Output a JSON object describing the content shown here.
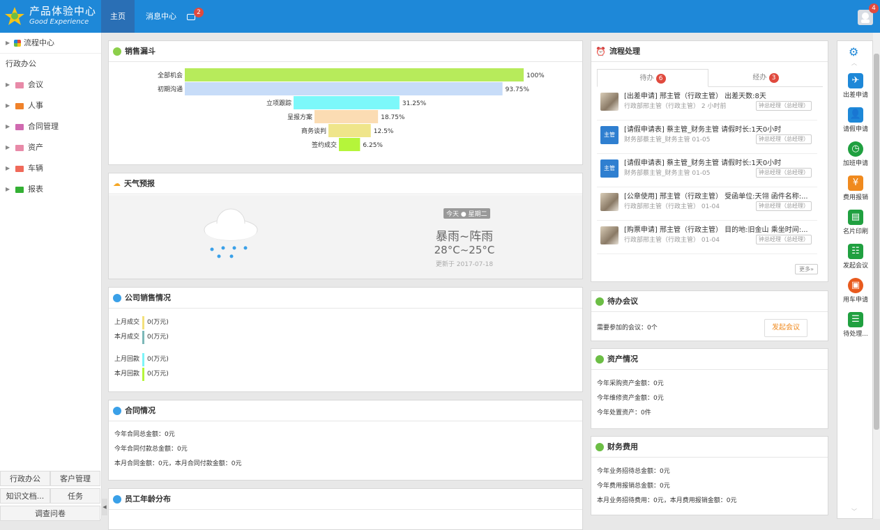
{
  "topbar": {
    "brand_title": "产品体验中心",
    "brand_subtitle": "Good Experience",
    "nav_home": "主页",
    "nav_messages": "消息中心",
    "task_badge": "2",
    "user_badge": "4"
  },
  "sidebar": {
    "process_center": "流程中心",
    "group_title": "行政办公",
    "items": [
      {
        "label": "会议",
        "color": "#e88aa8"
      },
      {
        "label": "人事",
        "color": "#f0822a"
      },
      {
        "label": "合同管理",
        "color": "#d06ab0"
      },
      {
        "label": "资产",
        "color": "#e88aa8"
      },
      {
        "label": "车辆",
        "color": "#f06a5a"
      },
      {
        "label": "报表",
        "color": "#34b034"
      }
    ],
    "bottom_tabs": [
      "行政办公",
      "客户管理",
      "知识文档...",
      "任务",
      "调查问卷"
    ]
  },
  "sales_funnel": {
    "title": "销售漏斗",
    "chart_data": {
      "type": "bar",
      "categories": [
        "全部机会",
        "初期沟通",
        "立项跟踪",
        "呈报方案",
        "商务谈判",
        "签约成交"
      ],
      "values": [
        100,
        93.75,
        31.25,
        18.75,
        12.5,
        6.25
      ],
      "value_labels": [
        "100%",
        "93.75%",
        "31.25%",
        "18.75%",
        "12.5%",
        "6.25%"
      ],
      "colors": [
        "#b7eb5b",
        "#c7dcf8",
        "#7cf8fa",
        "#fbdcb3",
        "#efe58a",
        "#b5f53a"
      ]
    }
  },
  "weather": {
    "title": "天气预报",
    "day": "今天 ● 星期二",
    "condition": "暴雨~阵雨",
    "temperature": "28°C~25°C",
    "updated": "更新于 2017-07-18"
  },
  "company_sales": {
    "title": "公司销售情况",
    "rows": [
      {
        "label": "上月成交",
        "value": "0(万元)",
        "color": "#f3e07a"
      },
      {
        "label": "本月成交",
        "value": "0(万元)",
        "color": "#7cb8b8"
      },
      {
        "label": "上月回款",
        "value": "0(万元)",
        "color": "#7cf4f8"
      },
      {
        "label": "本月回款",
        "value": "0(万元)",
        "color": "#b5f53a"
      }
    ]
  },
  "contracts": {
    "title": "合同情况",
    "lines": [
      "今年合同总金额：0元",
      "今年合同付款总金额：0元",
      "本月合同金额：0元，本月合同付款金额：0元"
    ]
  },
  "employee_age": {
    "title": "员工年龄分布"
  },
  "workflow": {
    "title": "流程处理",
    "tab_todo": "待办",
    "tab_todo_count": "6",
    "tab_done": "经办",
    "tab_done_count": "3",
    "items": [
      {
        "title": "[出差申请] 邢主管（行政主管） 出差天数:8天",
        "sub": "行政部邢主管（行政主管） 2 小时前",
        "tag": "钟总经理（总经理）",
        "avatar": "photo"
      },
      {
        "title": "[请假申请表] 蔡主管_财务主管 请假时长:1天0小时",
        "sub": "财务部蔡主管_财务主管 01-05",
        "tag": "钟总经理（总经理）",
        "avatar": "主管"
      },
      {
        "title": "[请假申请表] 蔡主管_财务主管 请假时长:1天0小时",
        "sub": "财务部蔡主管_财务主管 01-05",
        "tag": "钟总经理（总经理）",
        "avatar": "主管"
      },
      {
        "title": "[公章使用] 邢主管（行政主管） 受函单位:天翎 函件名称:...",
        "sub": "行政部邢主管（行政主管） 01-04",
        "tag": "钟总经理（总经理）",
        "avatar": "photo"
      },
      {
        "title": "[购票申请] 邢主管（行政主管） 目的地:旧金山 乘坐时间:...",
        "sub": "行政部邢主管（行政主管） 01-04",
        "tag": "钟总经理（总经理）",
        "avatar": "photo"
      }
    ],
    "more": "更多»"
  },
  "meetings": {
    "title": "待办会议",
    "text": "需要参加的会议：0个",
    "button": "发起会议"
  },
  "assets": {
    "title": "资产情况",
    "lines": [
      "今年采购资产金额：0元",
      "今年维修资产金额：0元",
      "今年处置资产：0件"
    ]
  },
  "finance": {
    "title": "财务费用",
    "lines": [
      "今年业务招待总金额：0元",
      "今年费用报销总金额：0元",
      "本月业务招待费用：0元，本月费用报销金额：0元"
    ]
  },
  "quick_tools": [
    {
      "label": "出差申请",
      "icon": "plane-icon",
      "color": "#1e88d8"
    },
    {
      "label": "请假申请",
      "icon": "person-icon",
      "color": "#1e88d8"
    },
    {
      "label": "加班申请",
      "icon": "clock-icon",
      "color": "#20a040"
    },
    {
      "label": "费用报销",
      "icon": "money-icon",
      "color": "#f08a1e"
    },
    {
      "label": "名片印刷",
      "icon": "card-icon",
      "color": "#20a040"
    },
    {
      "label": "发起会议",
      "icon": "meeting-icon",
      "color": "#20a040"
    },
    {
      "label": "用车申请",
      "icon": "bus-icon",
      "color": "#e85a1e"
    },
    {
      "label": "待处理...",
      "icon": "pending-icon",
      "color": "#20a040"
    }
  ]
}
